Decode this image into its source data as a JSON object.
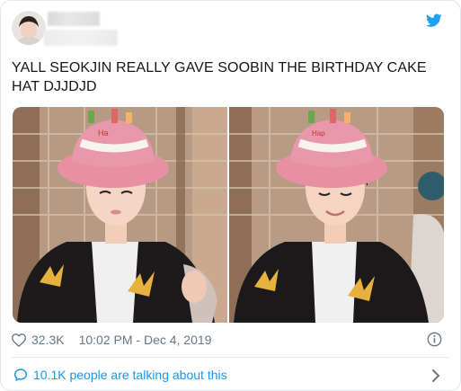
{
  "tweet": {
    "text": "YALL SEOKJIN REALLY GAVE SOOBIN THE BIRTHDAY CAKE HAT DJJDJD",
    "likes": "32.3K",
    "timestamp": "10:02 PM - Dec 4, 2019",
    "talking": "10.1K people are talking about this"
  },
  "colors": {
    "twitter_blue": "#1da1f2",
    "link_blue": "#1b95e0",
    "meta_gray": "#657786"
  },
  "icons": {
    "brand": "twitter-bird-icon",
    "like": "heart-icon",
    "info": "info-icon",
    "talking": "speech-bubble-icon",
    "more": "chevron-right-icon"
  }
}
